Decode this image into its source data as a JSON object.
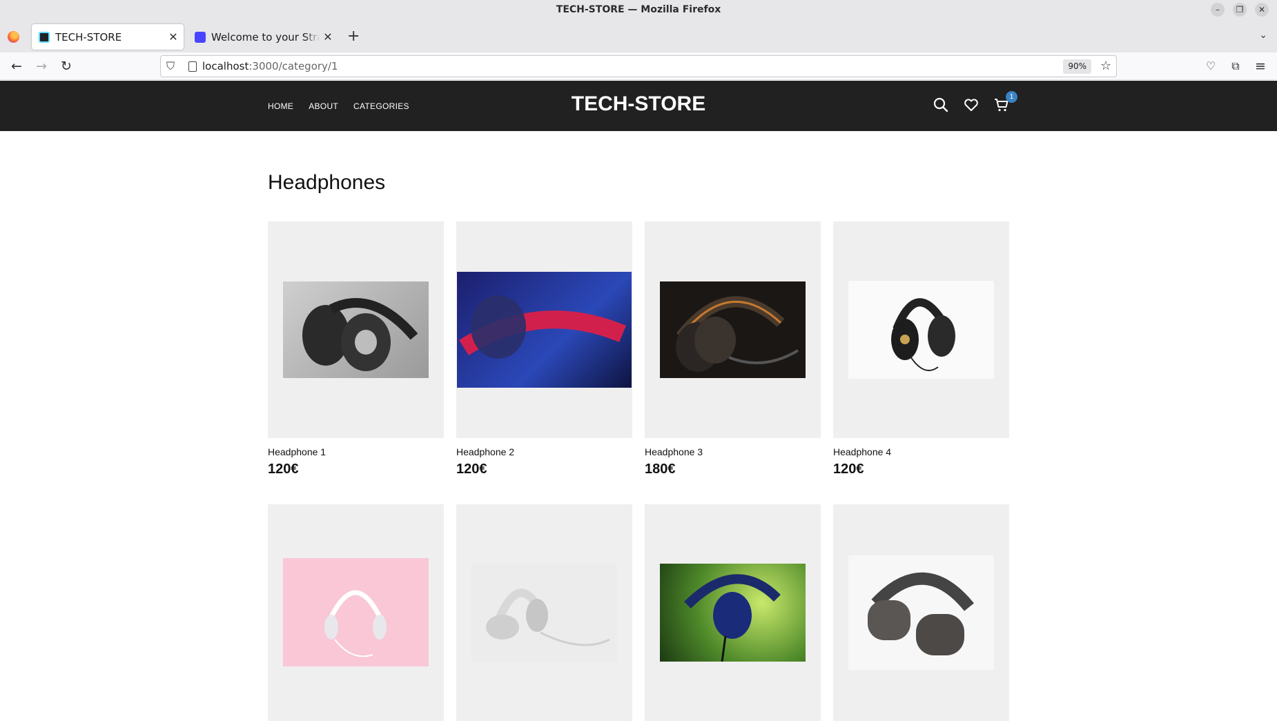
{
  "window": {
    "title": "TECH-STORE — Mozilla Firefox"
  },
  "tabs": [
    {
      "label": "TECH-STORE"
    },
    {
      "label": "Welcome to your Strapi a"
    }
  ],
  "address": {
    "host": "localhost",
    "path": ":3000/category/1",
    "zoom": "90%"
  },
  "site": {
    "brand": "TECH-STORE",
    "nav": [
      "HOME",
      "ABOUT",
      "CATEGORIES"
    ],
    "cart_count": "1"
  },
  "category": {
    "title": "Headphones"
  },
  "products": [
    {
      "name": "Headphone 1",
      "price": "120€"
    },
    {
      "name": "Headphone 2",
      "price": "120€"
    },
    {
      "name": "Headphone 3",
      "price": "180€"
    },
    {
      "name": "Headphone 4",
      "price": "120€"
    },
    {
      "name": "",
      "price": ""
    },
    {
      "name": "",
      "price": ""
    },
    {
      "name": "",
      "price": ""
    },
    {
      "name": "",
      "price": ""
    }
  ],
  "colors": {
    "header_bg": "#212121",
    "card_bg": "#efefef",
    "badge": "#3b82c4"
  }
}
